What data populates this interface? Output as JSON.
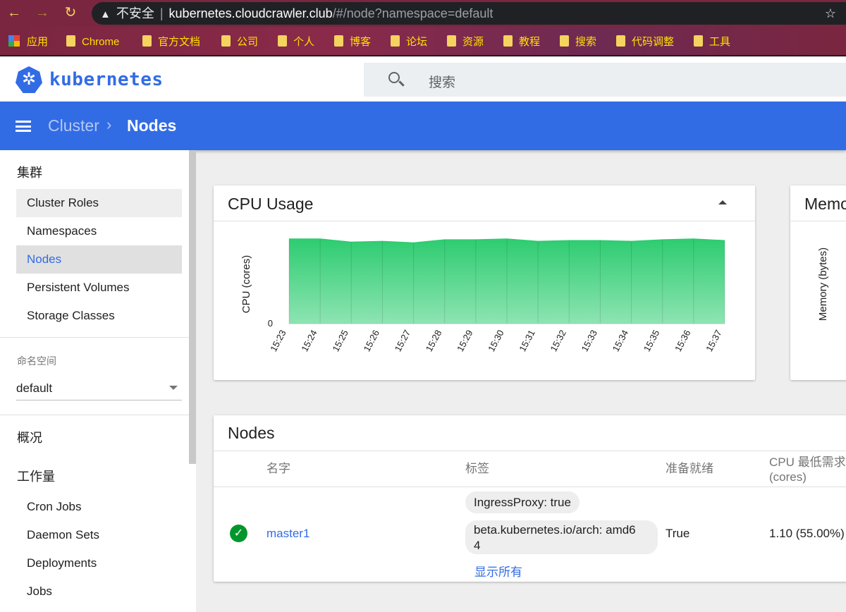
{
  "browser": {
    "security_label": "不安全",
    "url_host": "kubernetes.cloudcrawler.club",
    "url_path": "/#/node?namespace=default",
    "bookmarks": [
      "应用",
      "Chrome",
      "官方文档",
      "公司",
      "个人",
      "博客",
      "论坛",
      "资源",
      "教程",
      "搜索",
      "代码调整",
      "工具"
    ]
  },
  "header": {
    "logo_text": "kubernetes",
    "search_placeholder": "搜索"
  },
  "toolbar": {
    "breadcrumb_parent": "Cluster",
    "breadcrumb_current": "Nodes"
  },
  "sidebar": {
    "cluster_heading": "集群",
    "cluster_items": [
      "Cluster Roles",
      "Namespaces",
      "Nodes",
      "Persistent Volumes",
      "Storage Classes"
    ],
    "namespace_label": "命名空间",
    "namespace_value": "default",
    "overview": "概况",
    "workloads_heading": "工作量",
    "workload_items": [
      "Cron Jobs",
      "Daemon Sets",
      "Deployments",
      "Jobs"
    ]
  },
  "cpu_card": {
    "title": "CPU Usage"
  },
  "memory_card": {
    "title": "Memo"
  },
  "chart_data": [
    {
      "type": "area",
      "title": "CPU Usage",
      "ylabel": "CPU (cores)",
      "y_tick_labels": [
        "0"
      ],
      "x": [
        "15:23",
        "15:24",
        "15:25",
        "15:26",
        "15:27",
        "15:28",
        "15:29",
        "15:30",
        "15:31",
        "15:32",
        "15:33",
        "15:34",
        "15:35",
        "15:36",
        "15:37"
      ],
      "values": [
        1.1,
        1.1,
        1.06,
        1.07,
        1.05,
        1.09,
        1.09,
        1.1,
        1.07,
        1.08,
        1.08,
        1.07,
        1.09,
        1.1,
        1.08
      ],
      "ylim": [
        0,
        1.25
      ],
      "color": "#2ecc71"
    },
    {
      "type": "area",
      "title": "Memo",
      "ylabel": "Memory (bytes)"
    }
  ],
  "nodes_card": {
    "title": "Nodes",
    "columns": [
      "名字",
      "标签",
      "准备就绪",
      "CPU 最低需求",
      "(cores)"
    ],
    "rows": [
      {
        "name": "master1",
        "labels": [
          "IngressProxy: true",
          "beta.kubernetes.io/arch: amd6",
          "4"
        ],
        "show_all": "显示所有",
        "ready": "True",
        "cpu_requests": "1.10 (55.00%)"
      }
    ]
  }
}
